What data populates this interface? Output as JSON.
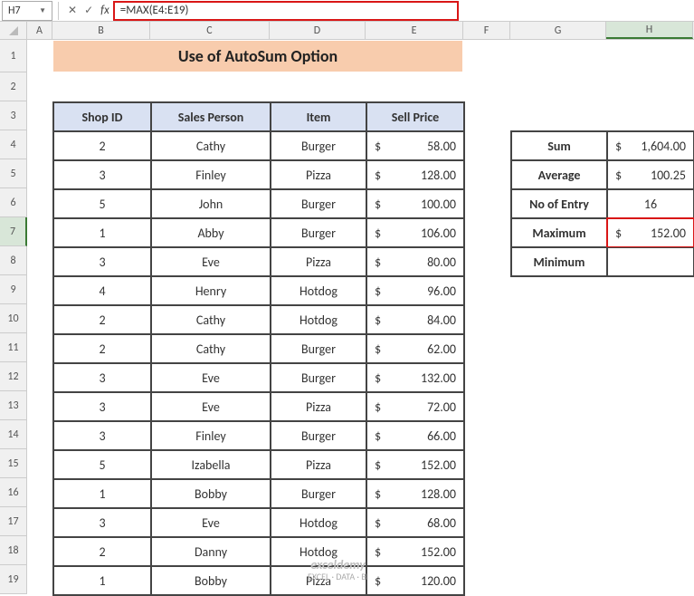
{
  "formula_bar": {
    "cell_ref": "H7",
    "formula": "=MAX(E4:E19)"
  },
  "columns": [
    "A",
    "B",
    "C",
    "D",
    "E",
    "F",
    "G",
    "H"
  ],
  "rows": [
    "1",
    "2",
    "3",
    "4",
    "5",
    "6",
    "7",
    "8",
    "9",
    "10",
    "11",
    "12",
    "13",
    "14",
    "15",
    "16",
    "17",
    "18",
    "19"
  ],
  "title": "Use of AutoSum Option",
  "table": {
    "headers": [
      "Shop ID",
      "Sales Person",
      "Item",
      "Sell Price"
    ],
    "rows": [
      {
        "shop": "2",
        "person": "Cathy",
        "item": "Burger",
        "cur": "$",
        "price": "58.00"
      },
      {
        "shop": "3",
        "person": "Finley",
        "item": "Pizza",
        "cur": "$",
        "price": "128.00"
      },
      {
        "shop": "5",
        "person": "John",
        "item": "Burger",
        "cur": "$",
        "price": "100.00"
      },
      {
        "shop": "1",
        "person": "Abby",
        "item": "Burger",
        "cur": "$",
        "price": "106.00"
      },
      {
        "shop": "3",
        "person": "Eve",
        "item": "Pizza",
        "cur": "$",
        "price": "80.00"
      },
      {
        "shop": "4",
        "person": "Henry",
        "item": "Hotdog",
        "cur": "$",
        "price": "96.00"
      },
      {
        "shop": "2",
        "person": "Cathy",
        "item": "Hotdog",
        "cur": "$",
        "price": "84.00"
      },
      {
        "shop": "2",
        "person": "Cathy",
        "item": "Burger",
        "cur": "$",
        "price": "62.00"
      },
      {
        "shop": "3",
        "person": "Eve",
        "item": "Burger",
        "cur": "$",
        "price": "132.00"
      },
      {
        "shop": "3",
        "person": "Eve",
        "item": "Pizza",
        "cur": "$",
        "price": "72.00"
      },
      {
        "shop": "3",
        "person": "Finley",
        "item": "Burger",
        "cur": "$",
        "price": "66.00"
      },
      {
        "shop": "5",
        "person": "Izabella",
        "item": "Pizza",
        "cur": "$",
        "price": "152.00"
      },
      {
        "shop": "1",
        "person": "Bobby",
        "item": "Burger",
        "cur": "$",
        "price": "128.00"
      },
      {
        "shop": "3",
        "person": "Eve",
        "item": "Hotdog",
        "cur": "$",
        "price": "68.00"
      },
      {
        "shop": "2",
        "person": "Danny",
        "item": "Hotdog",
        "cur": "$",
        "price": "152.00"
      },
      {
        "shop": "1",
        "person": "Bobby",
        "item": "Pizza",
        "cur": "$",
        "price": "120.00"
      }
    ]
  },
  "summary": {
    "rows": [
      {
        "label": "Sum",
        "cur": "$",
        "value": "1,604.00",
        "center": false,
        "highlight": false
      },
      {
        "label": "Average",
        "cur": "$",
        "value": "100.25",
        "center": false,
        "highlight": false
      },
      {
        "label": "No of Entry",
        "cur": "",
        "value": "16",
        "center": true,
        "highlight": false
      },
      {
        "label": "Maximum",
        "cur": "$",
        "value": "152.00",
        "center": false,
        "highlight": true
      },
      {
        "label": "Minimum",
        "cur": "",
        "value": "",
        "center": true,
        "highlight": false
      }
    ]
  },
  "watermark": {
    "brand": "exceldemy",
    "tag": "EXCEL · DATA · BI"
  }
}
